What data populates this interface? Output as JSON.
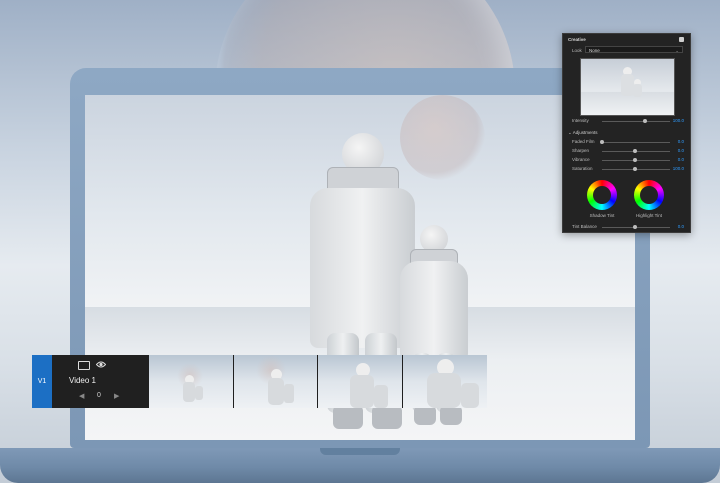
{
  "panel": {
    "title": "Creative",
    "look": {
      "label": "Look",
      "value": "None"
    },
    "intensity": {
      "label": "Intensity",
      "value": "100.0",
      "fraction": 0.6
    },
    "adjustments": {
      "label": "Adjustments",
      "items": [
        {
          "label": "Faded Film",
          "value": "0.0",
          "fraction": 0.0
        },
        {
          "label": "Sharpen",
          "value": "0.0",
          "fraction": 0.5
        },
        {
          "label": "Vibrance",
          "value": "0.0",
          "fraction": 0.5
        },
        {
          "label": "Saturation",
          "value": "100.0",
          "fraction": 0.5
        }
      ]
    },
    "wheels": {
      "shadow": "Shadow Tint",
      "highlight": "Highlight Tint"
    },
    "tint_balance": {
      "label": "Tint Balance",
      "value": "0.0",
      "fraction": 0.5
    },
    "accent_color": "#2f9cff"
  },
  "timeline": {
    "track_tag": "V1",
    "track_name": "Video 1",
    "keyframe_value": "0",
    "prev_symbol": "◀",
    "next_symbol": "▶",
    "tag_color": "#1c6fc4"
  }
}
